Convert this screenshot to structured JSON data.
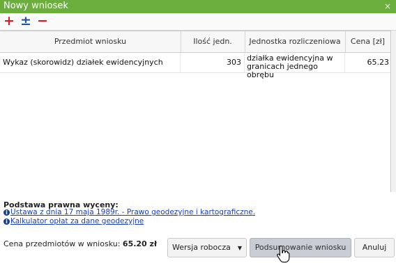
{
  "window": {
    "title": "Nowy wniosek",
    "close_glyph": "×"
  },
  "toolbar": {
    "add_glyph": "+",
    "toggle_glyph": "±",
    "remove_glyph": "−",
    "icons": [
      "plus-icon",
      "plus-minus-icon",
      "minus-icon"
    ]
  },
  "table": {
    "columns": [
      "Przedmiot wniosku",
      "Ilość jedn.",
      "Jednostka rozliczeniowa",
      "Cena [zł]"
    ],
    "rows": [
      {
        "item": "Wykaz (skorowidz) działek ewidencyjnych",
        "qty": "303",
        "unit": "działka ewidencyjna w granicach jednego obrębu",
        "price": "65.23"
      }
    ]
  },
  "footer": {
    "legal_title": "Podstawa prawna wyceny:",
    "link1": "Ustawa z dnia 17 maja 1989r. - Prawo geodezyjne i kartograficzne.",
    "link2": "Kalkulator opłat za dane geodezyjne",
    "info_glyph": "i",
    "summary_label": "Cena przedmiotów w wniosku:",
    "summary_value": "65.20 zł"
  },
  "buttons": {
    "draft": "Wersja robocza",
    "draft_arrow": "▼",
    "summarize": "Podsumowanie wniosku",
    "cancel": "Anuluj"
  },
  "colors": {
    "titlebar": "#6cae3e",
    "accent_red": "#d62020",
    "accent_blue": "#2255aa",
    "link": "#1a3fb5"
  }
}
